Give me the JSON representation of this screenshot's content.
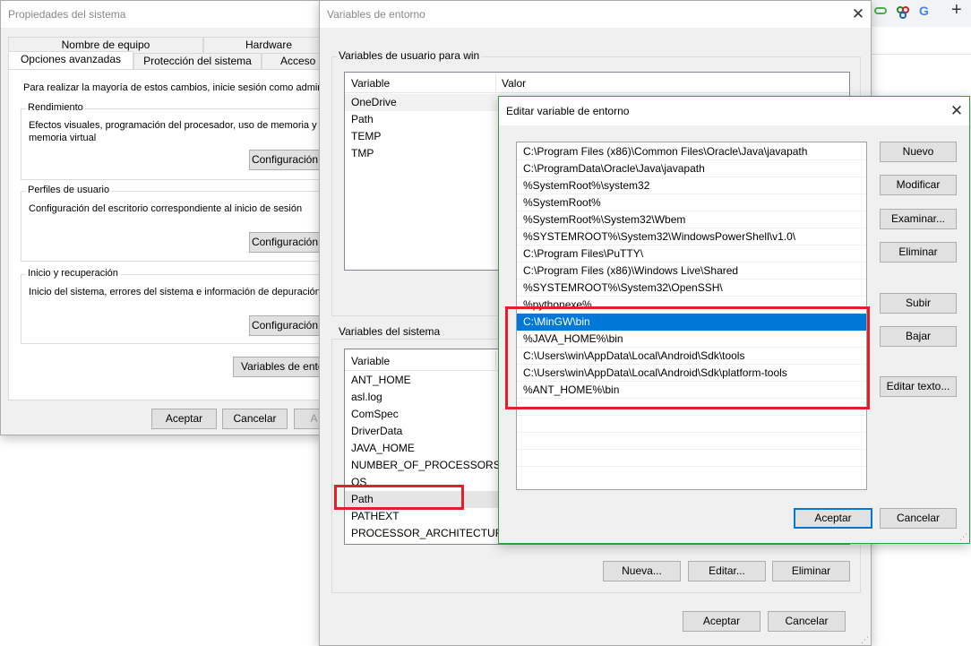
{
  "colors": {
    "highlight_red": "#e3202a",
    "selection_blue": "#0078d7",
    "dialog_bg": "#f0f0f0"
  },
  "browser_strip": {
    "add_icon": "+"
  },
  "system_props": {
    "title": "Propiedades del sistema",
    "tabs_row1": [
      "Nombre de equipo",
      "Hardware"
    ],
    "tabs_row2": [
      "Opciones avanzadas",
      "Protección del sistema",
      "Acceso re"
    ],
    "admin_note": "Para realizar la mayoría de estos cambios, inicie sesión como administr",
    "rendimiento": {
      "title": "Rendimiento",
      "desc_line1": "Efectos visuales, programación del procesador, uso de memoria y",
      "desc_line2": "memoria virtual",
      "button": "Configuración..."
    },
    "perfiles": {
      "title": "Perfiles de usuario",
      "desc": "Configuración del escritorio correspondiente al inicio de sesión",
      "button": "Configuración..."
    },
    "inicio": {
      "title": "Inicio y recuperación",
      "desc": "Inicio del sistema, errores del sistema e información de depuración",
      "button": "Configuración..."
    },
    "env_button": "Variables de entorno...",
    "ok": "Aceptar",
    "cancel": "Cancelar",
    "apply": "A"
  },
  "env_vars": {
    "title": "Variables de entorno",
    "user_section": "Variables de usuario para win",
    "col_variable": "Variable",
    "col_valor": "Valor",
    "user_vars": [
      "OneDrive",
      "Path",
      "TEMP",
      "TMP"
    ],
    "system_section": "Variables del sistema",
    "system_vars": [
      "ANT_HOME",
      "asl.log",
      "ComSpec",
      "DriverData",
      "JAVA_HOME",
      "NUMBER_OF_PROCESSORS",
      "OS",
      "Path",
      "PATHEXT",
      "PROCESSOR_ARCHITECTURE"
    ],
    "new_button": "Nueva...",
    "edit_button": "Editar...",
    "delete_button": "Eliminar",
    "ok": "Aceptar",
    "cancel": "Cancelar"
  },
  "edit_var": {
    "title": "Editar variable de entorno",
    "entries": [
      "C:\\Program Files (x86)\\Common Files\\Oracle\\Java\\javapath",
      "C:\\ProgramData\\Oracle\\Java\\javapath",
      "%SystemRoot%\\system32",
      "%SystemRoot%",
      "%SystemRoot%\\System32\\Wbem",
      "%SYSTEMROOT%\\System32\\WindowsPowerShell\\v1.0\\",
      "C:\\Program Files\\PuTTY\\",
      "C:\\Program Files (x86)\\Windows Live\\Shared",
      "%SYSTEMROOT%\\System32\\OpenSSH\\",
      "%pythonexe%",
      "C:\\MinGW\\bin",
      "%JAVA_HOME%\\bin",
      "C:\\Users\\win\\AppData\\Local\\Android\\Sdk\\tools",
      "C:\\Users\\win\\AppData\\Local\\Android\\Sdk\\platform-tools",
      "%ANT_HOME%\\bin"
    ],
    "selected_entry": "C:\\MinGW\\bin",
    "buttons": {
      "new": "Nuevo",
      "modify": "Modificar",
      "browse": "Examinar...",
      "delete": "Eliminar",
      "up": "Subir",
      "down": "Bajar",
      "edit_text": "Editar texto..."
    },
    "ok": "Aceptar",
    "cancel": "Cancelar"
  }
}
